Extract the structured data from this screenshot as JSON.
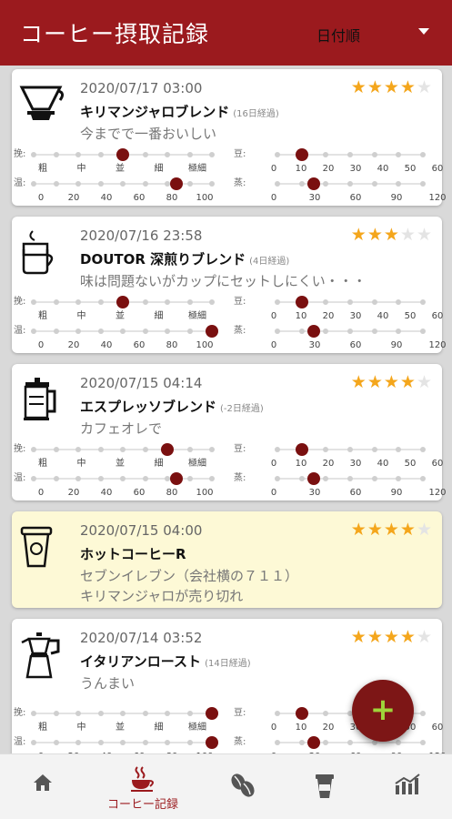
{
  "app": {
    "title": "コーヒー摂取記録",
    "sort_value": "日付順",
    "fab_label": "+"
  },
  "colors": {
    "primary": "#9b1a1e",
    "thumb": "#7a1010",
    "star": "#f4a61c",
    "highlight_bg": "#fdf9d6",
    "fab_plus": "#9fd43a"
  },
  "slider_labels": {
    "grind": "挽:",
    "temp": "温:",
    "beans": "豆:",
    "steam": "蒸:"
  },
  "ticks": {
    "grind": [
      "粗",
      "中",
      "並",
      "細",
      "極細"
    ],
    "temp": [
      "0",
      "20",
      "40",
      "60",
      "80",
      "100"
    ],
    "beans": [
      "0",
      "10",
      "20",
      "30",
      "40",
      "50",
      "60"
    ],
    "steam": [
      "0",
      "30",
      "60",
      "90",
      "120"
    ]
  },
  "records": [
    {
      "date": "2020/07/17 03:00",
      "name": "キリマンジャロブレンド",
      "age": "(16日経過)",
      "note": "今までで一番おいしい",
      "rating": 4,
      "icon": "dripper-icon",
      "grind": "並",
      "temp": 80,
      "beans": 10,
      "steam": 30
    },
    {
      "date": "2020/07/16 23:58",
      "name": "DOUTOR 深煎りブレンド",
      "age": "(4日経過)",
      "note": "味は問題ないがカップにセットしにくい・・・",
      "rating": 3,
      "icon": "drip-bag-icon",
      "grind": "並",
      "temp": 100,
      "beans": 10,
      "steam": 30
    },
    {
      "date": "2020/07/15 04:14",
      "name": "エスプレッソブレンド",
      "age": "(-2日経過)",
      "note": "カフェオレで",
      "rating": 4,
      "icon": "french-press-icon",
      "grind": "細",
      "temp": 80,
      "beans": 10,
      "steam": 30
    },
    {
      "date": "2020/07/15 04:00",
      "name": "ホットコーヒーR",
      "age": "",
      "note": "セブンイレブン（会社横の７１１）",
      "note2": "キリマンジャロが売り切れ",
      "rating": 4,
      "icon": "takeout-cup-icon"
    },
    {
      "date": "2020/07/14 03:52",
      "name": "イタリアンロースト",
      "age": "(14日経過)",
      "note": "うんまい",
      "rating": 4,
      "icon": "moka-pot-icon",
      "grind": "極細",
      "temp": 100,
      "beans": 10,
      "steam": 30
    }
  ],
  "bottom_nav": [
    {
      "name": "home",
      "icon": "home-icon",
      "label": ""
    },
    {
      "name": "records",
      "icon": "coffee-cup-icon",
      "label": "コーヒー記録"
    },
    {
      "name": "beans",
      "icon": "coffee-beans-icon",
      "label": ""
    },
    {
      "name": "cups",
      "icon": "takeout-cup-icon",
      "label": ""
    },
    {
      "name": "stats",
      "icon": "chart-icon",
      "label": ""
    }
  ]
}
